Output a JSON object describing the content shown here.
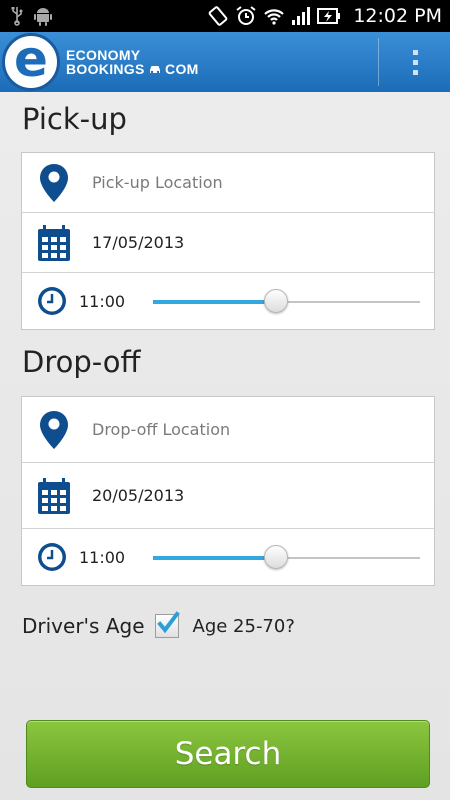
{
  "status_bar": {
    "time": "12:02 PM",
    "icons": [
      "usb-icon",
      "android-icon",
      "screen-rotate-icon",
      "alarm-icon",
      "wifi-icon",
      "signal-icon",
      "battery-charging-icon"
    ]
  },
  "app_bar": {
    "logo_line1": "ECONOMY",
    "logo_line2": "BOOKINGS",
    "logo_line2_suffix": "COM",
    "logo_letter": "e",
    "menu_icon": "overflow-menu-icon",
    "color": "#1c6cb8"
  },
  "pickup": {
    "title": "Pick-up",
    "location_placeholder": "Pick-up Location",
    "date": "17/05/2013",
    "time": "11:00",
    "time_slider_level": 0.46
  },
  "dropoff": {
    "title": "Drop-off",
    "location_placeholder": "Drop-off Location",
    "date": "20/05/2013",
    "time": "11:00",
    "time_slider_level": 0.46
  },
  "driver_age": {
    "label": "Driver's Age",
    "option": "Age 25-70?",
    "checked": true
  },
  "search_button": {
    "label": "Search",
    "color": "#6fae2b"
  },
  "colors": {
    "icon_blue": "#0e4e8f",
    "slider_accent": "#33a7e0"
  }
}
